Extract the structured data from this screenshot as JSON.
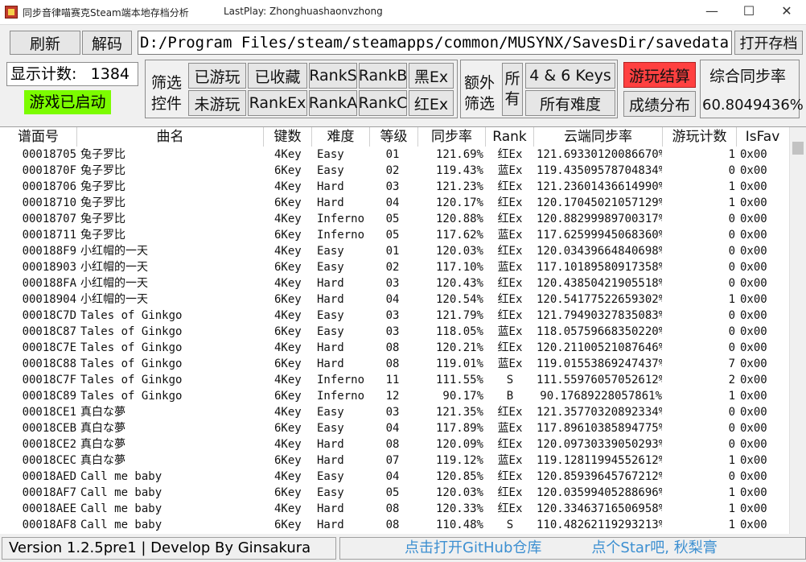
{
  "window": {
    "title": "同步音律喵赛克Steam端本地存档分析",
    "last_play": "LastPlay: Zhonghuashaonvzhong",
    "minimize": "—",
    "maximize": "☐",
    "close": "✕"
  },
  "toolbar": {
    "refresh": "刷新",
    "decode": "解码",
    "path": "D:/Program Files/steam/steamapps/common/MUSYNX/SavesDir/savedata.sav",
    "open_save": "打开存档"
  },
  "stats": {
    "count_label": "显示计数:",
    "count_value": "1384",
    "game_status": "游戏已启动"
  },
  "filters": {
    "label_line1": "筛选",
    "label_line2": "控件",
    "played": "已游玩",
    "favorited": "已收藏",
    "rank_s": "RankS",
    "rank_b": "RankB",
    "black_ex": "黑Ex",
    "unplayed": "未游玩",
    "rank_ex": "RankEx",
    "rank_a": "RankA",
    "rank_c": "RankC",
    "red_ex": "红Ex"
  },
  "extra": {
    "label_line1": "额外",
    "label_line2": "筛选",
    "all_line1": "所",
    "all_line2": "有",
    "keys": "4 & 6 Keys",
    "all_difficulty": "所有难度"
  },
  "actions": {
    "play_result": "游玩结算",
    "score_distribution": "成绩分布",
    "overall_label": "综合同步率",
    "overall_value": "60.8049436%"
  },
  "colors": {
    "accent_red": "#ff4040",
    "accent_green": "#7cfc00",
    "link_blue": "#3c8fd1"
  },
  "table": {
    "headers": [
      "谱面号",
      "曲名",
      "键数",
      "难度",
      "等级",
      "同步率",
      "Rank",
      "云端同步率",
      "游玩计数",
      "IsFav"
    ],
    "rows": [
      [
        "00018705",
        "兔子罗比",
        "4Key",
        "Easy",
        "01",
        "121.69%",
        "红Ex",
        "121.69330120086670%",
        "1",
        "0x00"
      ],
      [
        "0001870F",
        "兔子罗比",
        "6Key",
        "Easy",
        "02",
        "119.43%",
        "蓝Ex",
        "119.43509578704834%",
        "0",
        "0x00"
      ],
      [
        "00018706",
        "兔子罗比",
        "4Key",
        "Hard",
        "03",
        "121.23%",
        "红Ex",
        "121.23601436614990%",
        "1",
        "0x00"
      ],
      [
        "00018710",
        "兔子罗比",
        "6Key",
        "Hard",
        "04",
        "120.17%",
        "红Ex",
        "120.17045021057129%",
        "1",
        "0x00"
      ],
      [
        "00018707",
        "兔子罗比",
        "4Key",
        "Inferno",
        "05",
        "120.88%",
        "红Ex",
        "120.88299989700317%",
        "0",
        "0x00"
      ],
      [
        "00018711",
        "兔子罗比",
        "6Key",
        "Inferno",
        "05",
        "117.62%",
        "蓝Ex",
        "117.62599945068360%",
        "0",
        "0x00"
      ],
      [
        "000188F9",
        "小红帽的一天",
        "4Key",
        "Easy",
        "01",
        "120.03%",
        "红Ex",
        "120.03439664840698%",
        "0",
        "0x00"
      ],
      [
        "00018903",
        "小红帽的一天",
        "6Key",
        "Easy",
        "02",
        "117.10%",
        "蓝Ex",
        "117.10189580917358%",
        "0",
        "0x00"
      ],
      [
        "000188FA",
        "小红帽的一天",
        "4Key",
        "Hard",
        "03",
        "120.43%",
        "红Ex",
        "120.43850421905518%",
        "0",
        "0x00"
      ],
      [
        "00018904",
        "小红帽的一天",
        "6Key",
        "Hard",
        "04",
        "120.54%",
        "红Ex",
        "120.54177522659302%",
        "1",
        "0x00"
      ],
      [
        "00018C7D",
        "Tales of Ginkgo",
        "4Key",
        "Easy",
        "03",
        "121.79%",
        "红Ex",
        "121.79490327835083%",
        "0",
        "0x00"
      ],
      [
        "00018C87",
        "Tales of Ginkgo",
        "6Key",
        "Easy",
        "03",
        "118.05%",
        "蓝Ex",
        "118.05759668350220%",
        "0",
        "0x00"
      ],
      [
        "00018C7E",
        "Tales of Ginkgo",
        "4Key",
        "Hard",
        "08",
        "120.21%",
        "红Ex",
        "120.21100521087646%",
        "0",
        "0x00"
      ],
      [
        "00018C88",
        "Tales of Ginkgo",
        "6Key",
        "Hard",
        "08",
        "119.01%",
        "蓝Ex",
        "119.01553869247437%",
        "7",
        "0x00"
      ],
      [
        "00018C7F",
        "Tales of Ginkgo",
        "4Key",
        "Inferno",
        "11",
        "111.55%",
        "S",
        "111.55976057052612%",
        "2",
        "0x00"
      ],
      [
        "00018C89",
        "Tales of Ginkgo",
        "6Key",
        "Inferno",
        "12",
        "90.17%",
        "B",
        "90.17689228057861%",
        "1",
        "0x00"
      ],
      [
        "00018CE1",
        "真白な夢",
        "4Key",
        "Easy",
        "03",
        "121.35%",
        "红Ex",
        "121.35770320892334%",
        "0",
        "0x00"
      ],
      [
        "00018CEB",
        "真白な夢",
        "6Key",
        "Easy",
        "04",
        "117.89%",
        "蓝Ex",
        "117.89610385894775%",
        "0",
        "0x00"
      ],
      [
        "00018CE2",
        "真白な夢",
        "4Key",
        "Hard",
        "08",
        "120.09%",
        "红Ex",
        "120.09730339050293%",
        "0",
        "0x00"
      ],
      [
        "00018CEC",
        "真白な夢",
        "6Key",
        "Hard",
        "07",
        "119.12%",
        "蓝Ex",
        "119.12811994552612%",
        "1",
        "0x00"
      ],
      [
        "00018AED",
        "Call me baby",
        "4Key",
        "Easy",
        "04",
        "120.85%",
        "红Ex",
        "120.85939645767212%",
        "0",
        "0x00"
      ],
      [
        "00018AF7",
        "Call me baby",
        "6Key",
        "Easy",
        "05",
        "120.03%",
        "红Ex",
        "120.03599405288696%",
        "1",
        "0x00"
      ],
      [
        "00018AEE",
        "Call me baby",
        "4Key",
        "Hard",
        "08",
        "120.33%",
        "红Ex",
        "120.33463716506958%",
        "1",
        "0x00"
      ],
      [
        "00018AF8",
        "Call me baby",
        "6Key",
        "Hard",
        "08",
        "110.48%",
        "S",
        "110.48262119293213%",
        "1",
        "0x00"
      ]
    ]
  },
  "status": {
    "version": "Version 1.2.5pre1 | Develop By Ginsakura",
    "github_link": "点击打开GitHub仓库",
    "star_link": "点个Star吧, 秋梨膏"
  }
}
